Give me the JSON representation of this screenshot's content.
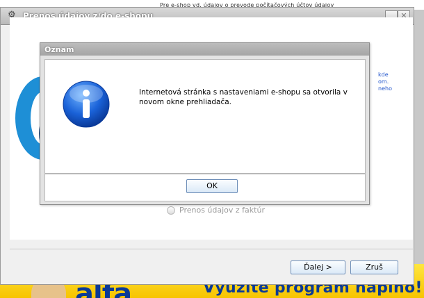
{
  "background": {
    "top_text": "Pre e-shop vd. údajov o prevode počítačových účtov údajov",
    "right_text": [
      "kde",
      "om.",
      "neho"
    ],
    "ad_logo": "alfa",
    "ad_slogan": "Využite program napíno!"
  },
  "window": {
    "title": "Prenos údajov z/do e-shopu",
    "minimize_label": "_",
    "close_label": "✕",
    "radio_label": "Prenos údajov z faktúr",
    "next_label": "Ďalej >",
    "cancel_label": "Zruš"
  },
  "dialog": {
    "title": "Oznam",
    "message": "Internetová stránka s nastaveniami e-shopu sa otvorila v novom okne prehliadača.",
    "ok_label": "OK",
    "icon": "info-icon"
  },
  "colors": {
    "info_blue": "#1a62d8",
    "gear_blue": "#1e8fd6",
    "ad_yellow": "#f7c400"
  }
}
